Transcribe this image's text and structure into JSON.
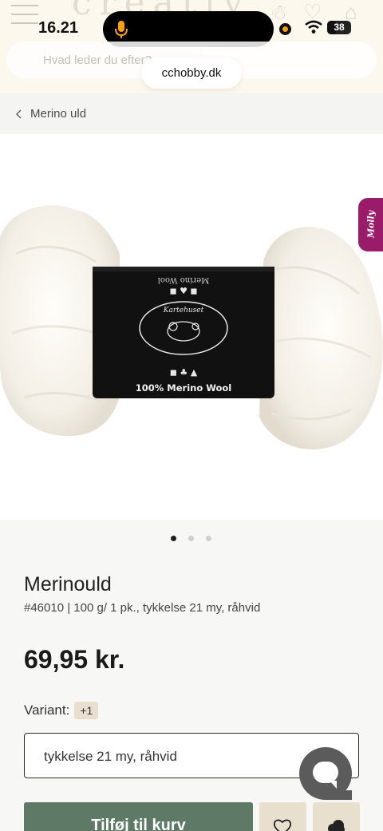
{
  "status_bar": {
    "time": "16.21",
    "battery": "38",
    "battery_level": 0.38
  },
  "browser": {
    "url": "cchobby.dk"
  },
  "header": {
    "search_placeholder": "Hvad leder du efter?"
  },
  "breadcrumb": {
    "label": "Merino uld"
  },
  "product_image": {
    "band_brand": "Kartehuset",
    "band_text": "100% Merino Wool",
    "slides_total": 3,
    "active_slide": 1
  },
  "side_tab": {
    "label": "Molly"
  },
  "product": {
    "title": "Merinould",
    "subtitle": "#46010  | 100 g/ 1 pk., tykkelse 21 my, råhvid",
    "price": "69,95 kr."
  },
  "variant": {
    "label": "Variant:",
    "badge": "+1",
    "selected": "tykkelse 21 my, råhvid"
  },
  "actions": {
    "add_to_cart": "Tilføj til kurv"
  },
  "colors": {
    "header_bg": "#fcf8ee",
    "cart_button": "#5e7a67",
    "beige": "#e9dfcf",
    "molly": "#9b1b6b",
    "chat": "#5b5b5b"
  }
}
